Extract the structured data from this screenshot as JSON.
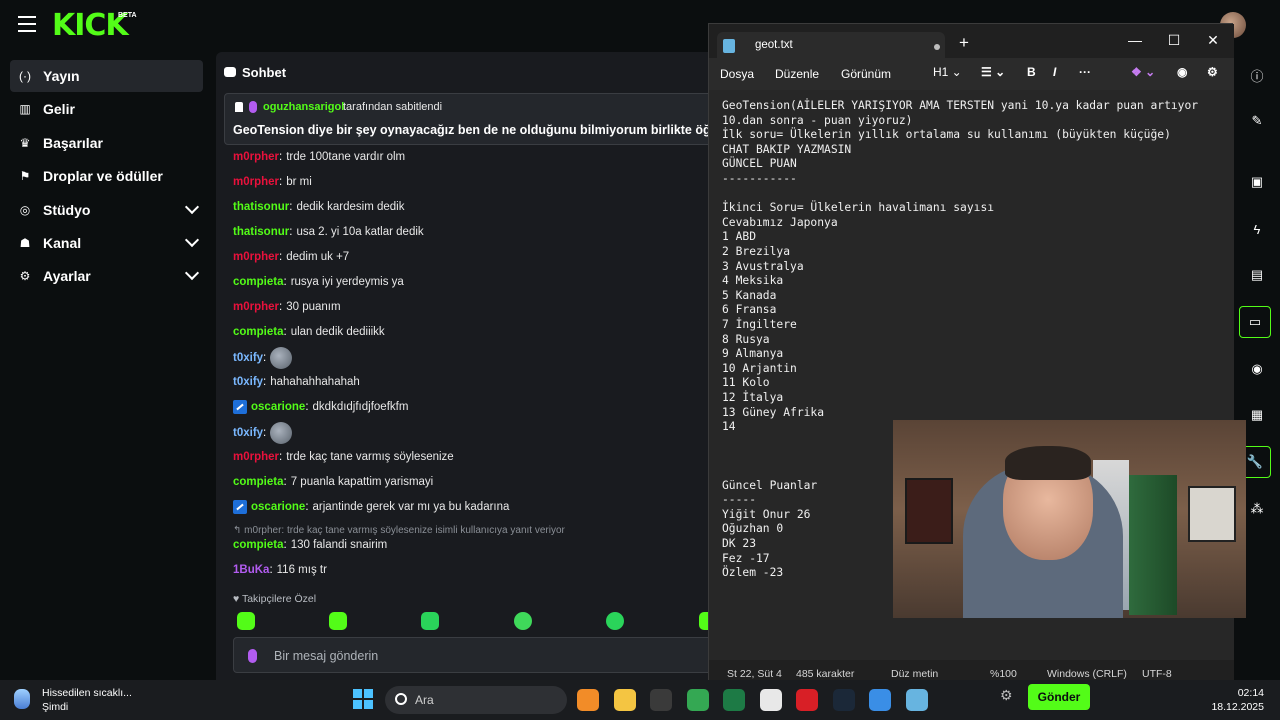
{
  "header": {
    "logo": "KICK",
    "logo_badge": "BETA"
  },
  "sidebar": {
    "items": [
      {
        "label": "Yayın",
        "icon": "broadcast-icon",
        "active": true,
        "expandable": false
      },
      {
        "label": "Gelir",
        "icon": "revenue-icon",
        "active": false,
        "expandable": false
      },
      {
        "label": "Başarılar",
        "icon": "trophy-icon",
        "active": false,
        "expandable": false
      },
      {
        "label": "Droplar ve ödüller",
        "icon": "drops-icon",
        "active": false,
        "expandable": false
      },
      {
        "label": "Stüdyo",
        "icon": "studio-icon",
        "active": false,
        "expandable": true
      },
      {
        "label": "Kanal",
        "icon": "channel-icon",
        "active": false,
        "expandable": true
      },
      {
        "label": "Ayarlar",
        "icon": "gear-icon",
        "active": false,
        "expandable": true
      }
    ]
  },
  "chat": {
    "title": "Sohbet",
    "pinned": {
      "user": "oguzhansarigol",
      "by_text": "tarafından sabitlendi",
      "text": "GeoTension diye bir şey oynayacağız ben de ne olduğunu bilmiyorum birlikte öğrenicez"
    },
    "messages": [
      {
        "user": "m0rpher",
        "text": "trde 100tane vardır olm",
        "color": "#e9113c"
      },
      {
        "user": "m0rpher",
        "text": "br mi",
        "color": "#e9113c"
      },
      {
        "user": "thatisonur",
        "text": "dedik kardesim dedik",
        "color": "#53fc18"
      },
      {
        "user": "thatisonur",
        "text": "usa 2. yi 10a katlar dedik",
        "color": "#53fc18"
      },
      {
        "user": "m0rpher",
        "text": "dedim uk +7",
        "color": "#e9113c"
      },
      {
        "user": "compieta",
        "text": "rusya iyi yerdeymis ya",
        "color": "#53fc18"
      },
      {
        "user": "m0rpher",
        "text": "30 puanım",
        "color": "#e9113c"
      },
      {
        "user": "compieta",
        "text": "ulan dedik dediiikk",
        "color": "#53fc18"
      },
      {
        "user": "t0xify",
        "text": "",
        "color": "#7ab8ff",
        "emote": true
      },
      {
        "user": "t0xify",
        "text": "hahahahhahahah",
        "color": "#7ab8ff"
      },
      {
        "user": "oscarione",
        "text": "dkdkdıdjfıdjfoefkfm",
        "color": "#53fc18",
        "badge": true
      },
      {
        "user": "t0xify",
        "text": "",
        "color": "#7ab8ff",
        "emote": true
      },
      {
        "user": "m0rpher",
        "text": "trde kaç tane varmış söylesenize",
        "color": "#e9113c"
      },
      {
        "user": "compieta",
        "text": "7 puanla kapattim yarismayi",
        "color": "#53fc18"
      },
      {
        "user": "oscarione",
        "text": "arjantinde gerek var mı ya bu kadarına",
        "color": "#53fc18",
        "badge": true
      }
    ],
    "reply": "m0rpher: trde kaç tane varmış söylesenize isimli kullanıcıya yanıt veriyor",
    "after_reply": [
      {
        "user": "compieta",
        "text": "130 falandi snairim",
        "color": "#53fc18"
      },
      {
        "user": "1BuKa",
        "text": "116 mış tr",
        "color": "#b25cf0"
      }
    ],
    "followers_label": "Takipçilere Özel",
    "input_placeholder": "Bir mesaj gönderin"
  },
  "notepad": {
    "tab_title": "geot.txt",
    "menu": [
      "Dosya",
      "Düzenle",
      "Görünüm"
    ],
    "heading": "H1",
    "lines": [
      "GeoTension(AİLELER YARIŞIYOR AMA TERSTEN yani 10.ya kadar puan artıyor",
      "10.dan sonra - puan yiyoruz)",
      "İlk soru= Ülkelerin yıllık ortalama su kullanımı (büyükten küçüğe)",
      "CHAT BAKIP YAZMASIN",
      "GÜNCEL PUAN",
      "-----------",
      "",
      "İkinci Soru= Ülkelerin havalimanı sayısı",
      "Cevabımız Japonya",
      "1 ABD",
      "2 Brezilya",
      "3 Avustralya",
      "4 Meksika",
      "5 Kanada",
      "6 Fransa",
      "7 İngiltere",
      "8 Rusya",
      "9 Almanya",
      "10 Arjantin",
      "11 Kolo",
      "12 İtalya",
      "13 Güney Afrika",
      "14",
      "",
      "",
      "",
      "Güncel Puanlar",
      "-----",
      "Yiğit Onur 26",
      "Oğuzhan 0",
      "DK 23",
      "Fez -17",
      "Özlem -23"
    ],
    "status": {
      "position": "St 22, Süt 4",
      "chars": "485 karakter",
      "format": "Düz metin",
      "zoom": "%100",
      "line_ending": "Windows (CRLF)",
      "encoding": "UTF-8"
    }
  },
  "taskbar": {
    "weather_line1": "Hissedilen sıcaklı...",
    "weather_line2": "Şimdi",
    "search_placeholder": "Ara",
    "send_button": "Gönder",
    "time": "02:14",
    "date": "18.12.2025",
    "apps": [
      {
        "name": "search-app-icon",
        "color": "#f28c28"
      },
      {
        "name": "file-explorer-icon",
        "color": "#f4c542"
      },
      {
        "name": "obs-icon",
        "color": "#3a3a3a"
      },
      {
        "name": "chrome-icon",
        "color": "#34a853"
      },
      {
        "name": "excel-icon",
        "color": "#1d7a45"
      },
      {
        "name": "capcut-icon",
        "color": "#e8e8e8"
      },
      {
        "name": "opera-icon",
        "color": "#d81f26"
      },
      {
        "name": "steam-icon",
        "color": "#1b2838"
      },
      {
        "name": "photos-icon",
        "color": "#3a8ee6"
      },
      {
        "name": "notepad-icon",
        "color": "#67b4e0"
      }
    ]
  }
}
